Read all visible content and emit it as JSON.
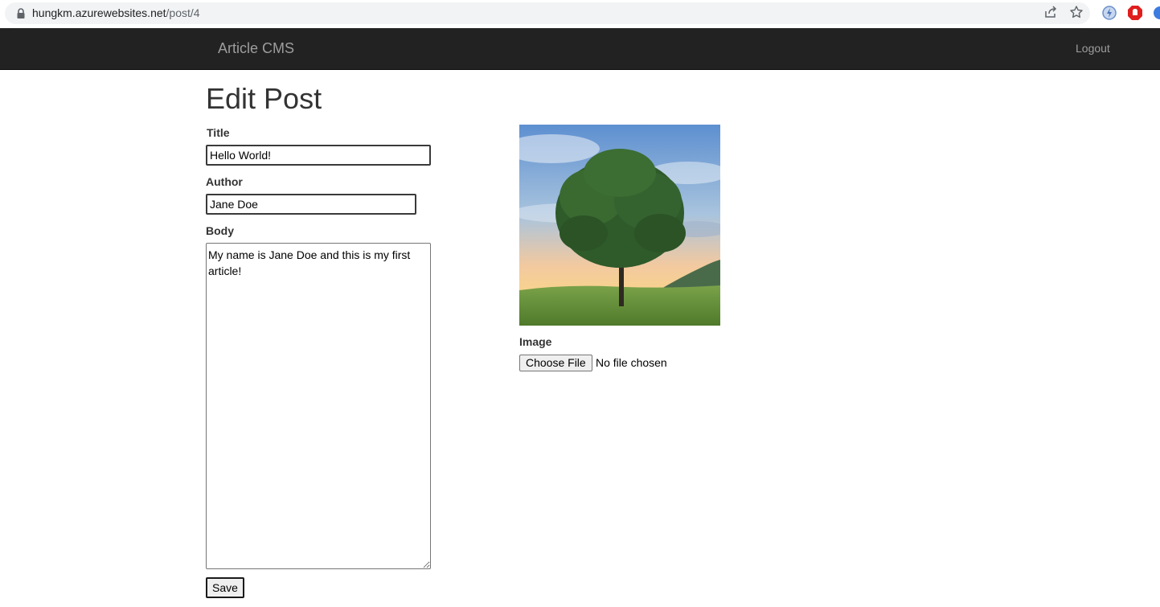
{
  "browser": {
    "url_host": "hungkm.azurewebsites.net",
    "url_path": "/post/4"
  },
  "navbar": {
    "brand": "Article CMS",
    "logout": "Logout"
  },
  "page": {
    "title": "Edit Post"
  },
  "form": {
    "title_label": "Title",
    "title_value": "Hello World!",
    "author_label": "Author",
    "author_value": "Jane Doe",
    "body_label": "Body",
    "body_value": "My name is Jane Doe and this is my first article!",
    "save_label": "Save"
  },
  "image_field": {
    "label": "Image",
    "choose_file_label": "Choose File",
    "file_status": "No file chosen"
  },
  "colors": {
    "navbar_bg": "#222222",
    "navbar_text": "#9d9d9d"
  }
}
